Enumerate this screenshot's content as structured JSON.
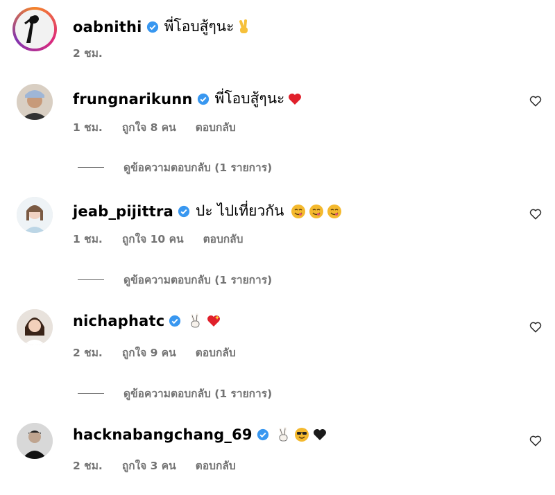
{
  "comments": [
    {
      "username": "oabnithi",
      "text": "พี่โอบสู้ๆนะ",
      "time": "2 ชม.",
      "likes": "",
      "reply": "",
      "view_replies": ""
    },
    {
      "username": "frungnarikunn",
      "text": "พี่โอบสู้ๆนะ",
      "time": "1 ชม.",
      "likes": "ถูกใจ 8 คน",
      "reply": "ตอบกลับ",
      "view_replies": "ดูข้อความตอบกลับ (1 รายการ)"
    },
    {
      "username": "jeab_pijittra",
      "text": "ปะ ไปเที่ยวกัน",
      "time": "1 ชม.",
      "likes": "ถูกใจ 10 คน",
      "reply": "ตอบกลับ",
      "view_replies": "ดูข้อความตอบกลับ (1 รายการ)"
    },
    {
      "username": "nichaphatc",
      "text": "",
      "time": "2 ชม.",
      "likes": "ถูกใจ 9 คน",
      "reply": "ตอบกลับ",
      "view_replies": "ดูข้อความตอบกลับ (1 รายการ)"
    },
    {
      "username": "hacknabangchang_69",
      "text": "",
      "time": "2 ชม.",
      "likes": "ถูกใจ 3 คน",
      "reply": "ตอบกลับ",
      "view_replies": ""
    }
  ],
  "icons": {
    "verified": "verified-badge-icon",
    "like": "heart-outline-icon"
  },
  "colors": {
    "verified": "#3897f0",
    "meta_text": "#737373",
    "story_ring": "#dd2a7b"
  }
}
